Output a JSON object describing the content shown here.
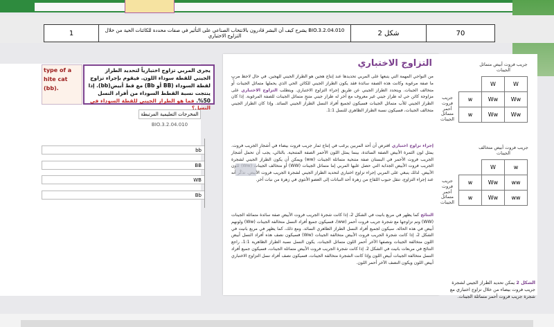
{
  "header": {
    "page_num": "70",
    "figure": "شكل 2",
    "description": "يشرح كيف أن البشر قادرون بالانتخاب الصناعي على التأثير في صفات محددة للكائنات الحية من خلال   التزاوج الاختباري",
    "code": "BIO.3.2.04.010",
    "count": "1"
  },
  "left": {
    "peach_line1": "type of a",
    "peach_line2": "hite cat (bb).",
    "question": "يجرى المربي تزاوج اختبارياً لتحديد الطراز الجيني للقطة سوداء اللون. فيقوم بإجراء تزاوج لقطة السوداء (BB أو Bb) مع قط أبيض(bb). إذا ينتجت نسبة القطط السوداء من أفراد النسل 50%.",
    "question_red": "فما هو الطراز الجيني للقطة السوداء في النسل؟",
    "outcomes_title": "المخرجات التعليمية المرتبطة",
    "outcomes_code": "BIO.3.2.04.010",
    "fields": [
      "bb",
      "BB",
      "WB",
      "Bb"
    ]
  },
  "main": {
    "title": "التزاوج الاختباري",
    "p1": "من النواحي المهمة التي يتبعها على المربي تحديدها عند إنتاج هجين هو الطراز الجيني للهجين. في حال لاحظ مربٍ ما صفة مرغوبة وكانت هذه الصفة سائدة فقد يكون الطراز الجيني للكائن الحي الذي يحملها متماثل الجينات أو متخالف الجينات. ويتحدد الطراز الجيني عن طريق إجراء التزاوج الاختباري. ويتطلب",
    "kw1": "التزاوج الاختباري",
    "p1b": "على مزاوجة كائن حي له طراز جيني غير معروف مع آخر له طراز جيني متنحٍ متماثل الجينات للصفة المرغوبة. إذا كان الطراز الجيني للأب متماثل الجينات فسيكون لجميع أفراد النسل الطراز الجيني السائد. وإذا كان الطراز الجيني متخالف الجينات، فسيكون نسبة الطراز الظاهري للنسل 1:1.",
    "kw2": "إجراء تزاوج اختباري",
    "p2": "افترض أن أحد المربين يرغب في إنتاج ثمار جريب فروت بيضاء في أشجار الجريب فروت. يمثل لون الثمرة الأبيض الصفة السائدة، بينما يمثل اللون الأحمر الصفة المتنحية. بالتالي، يجب أن تحمل أشجار الجريب فروت الأحمر في البستان صفة متنحية متماثلة الجينات (ww) ويمكن أن يكون الطراز الجيني لشجرة الجريب فروت الأبيض الجذابة التي حصل عليها المربي إما متماثل الجينات (WW) أو متخالف الجينات (Ww) للون الأبيض. لذلك ينبغي على المربي إجراء تزاوج اختباري لتحديد الطراز الجيني لشجرة الجريب فروت الأبيض. تذكّر أنه عند إجراء التزاوج، تنقل حبوب اللقاح من زهرة أحد النباتات إلى العضو الأنثوي في زهرة من نبات آخر.",
    "kw3": "النتائج",
    "p3": "كما يظهر في مربع بانيت في الشكل 2، إذا كانت شجرة الجريب فروت الأبيض صفة سائدة متماثلة الجينات (WW) وتم تزاوجها مع شجرة جريب فروت أحمر (ww)، فسيكون جميع أفراد النسل متخالفة الجينات (Ww) ولونهم أبيض في هذه الحالة. سيكون لجميع أفراد النسل الطراز الظاهري السائد. ومع ذلك، كما يظهر في مربع بانيت في الشكل 2، إذا كانت شجرة الجريب فروت الأبيض متخالفة الجينات (Ww) فسيكون نصف هذه أفراد النسل أبيض اللون متخالفة الجينات ونصفها الآخر أحمر اللون متماثل الجينات. يكون النسل نسبة الطراز الظاهرية 1:1، راجع النتائج في مربعات بانيت في الشكل 2. إذا كانت شجرة الجريب فروت الأبيض متماثلة الجينات، فسيكون جميع أفراد النسل متخالفة الجينات أبيض اللون وإذا كانت الشجرة متخالفة الجينات، فسيكون نصف أفراد نسل التزاوج الاختباري أبيض اللون ويكون النصف الآخر أحمر اللون."
  },
  "figure": {
    "grid1_top": "جريب فروت أبيض متماثل الجينات",
    "grid1_side": "جريب فروت أحمر متماثل الجينات",
    "grid1_header": [
      "W",
      "W"
    ],
    "grid1_rows": [
      [
        "w",
        "Ww",
        "Ww"
      ],
      [
        "w",
        "Ww",
        "Ww"
      ]
    ],
    "grid2_top": "جريب فروت أبيض متخالف الجينات",
    "grid2_side": "جريب فروت أحمر متماثل الجينات",
    "grid2_header": [
      "W",
      "w"
    ],
    "grid2_rows": [
      [
        "w",
        "Ww",
        "ww"
      ],
      [
        "w",
        "Ww",
        "ww"
      ]
    ],
    "caption_label": "الشكل 2",
    "caption": "يمكن تحديد الطراز الجيني لشجرة جريب فروت بيضاء من خلال تزاوج اختباري مع شجرة جريب فروت أحمر متماثلة الجينات."
  }
}
